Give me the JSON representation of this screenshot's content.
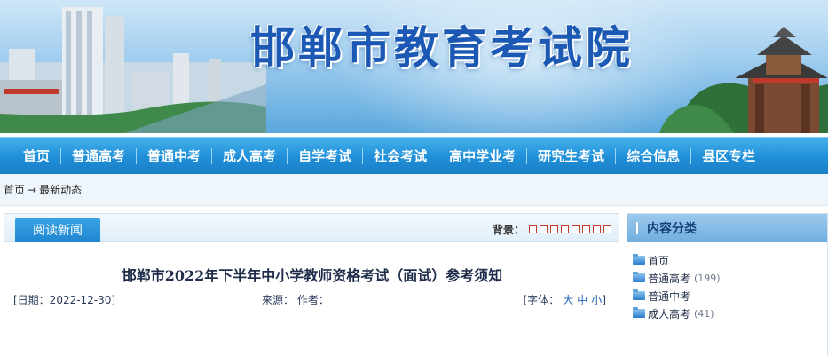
{
  "site": {
    "title": "邯郸市教育考试院"
  },
  "nav": {
    "items": [
      {
        "label": "首页"
      },
      {
        "label": "普通高考"
      },
      {
        "label": "普通中考"
      },
      {
        "label": "成人高考"
      },
      {
        "label": "自学考试"
      },
      {
        "label": "社会考试"
      },
      {
        "label": "高中学业考"
      },
      {
        "label": "研究生考试"
      },
      {
        "label": "综合信息"
      },
      {
        "label": "县区专栏"
      }
    ]
  },
  "breadcrumb": {
    "home": "首页",
    "arrow": "→",
    "current": "最新动态"
  },
  "article": {
    "tab_label": "阅读新闻",
    "background_label": "背景：",
    "background_swatch_count": 8,
    "title": "邯郸市2022年下半年中小学教师资格考试（面试）参考须知",
    "date": "[日期：2022-12-30]",
    "source": "来源：  作者：",
    "font_prefix": "[字体：",
    "font_sizes": [
      "大",
      "中",
      "小"
    ],
    "font_suffix": "]"
  },
  "sidebar": {
    "title": "内容分类",
    "categories": [
      {
        "name": "首页",
        "count": ""
      },
      {
        "name": "普通高考",
        "count": "(199)"
      },
      {
        "name": "普通中考",
        "count": ""
      },
      {
        "name": "成人高考",
        "count": "(41)"
      }
    ]
  },
  "colors": {
    "nav": "#1f8fd8",
    "title_blue": "#1b59b4",
    "swatch_border": "#c0392b"
  }
}
